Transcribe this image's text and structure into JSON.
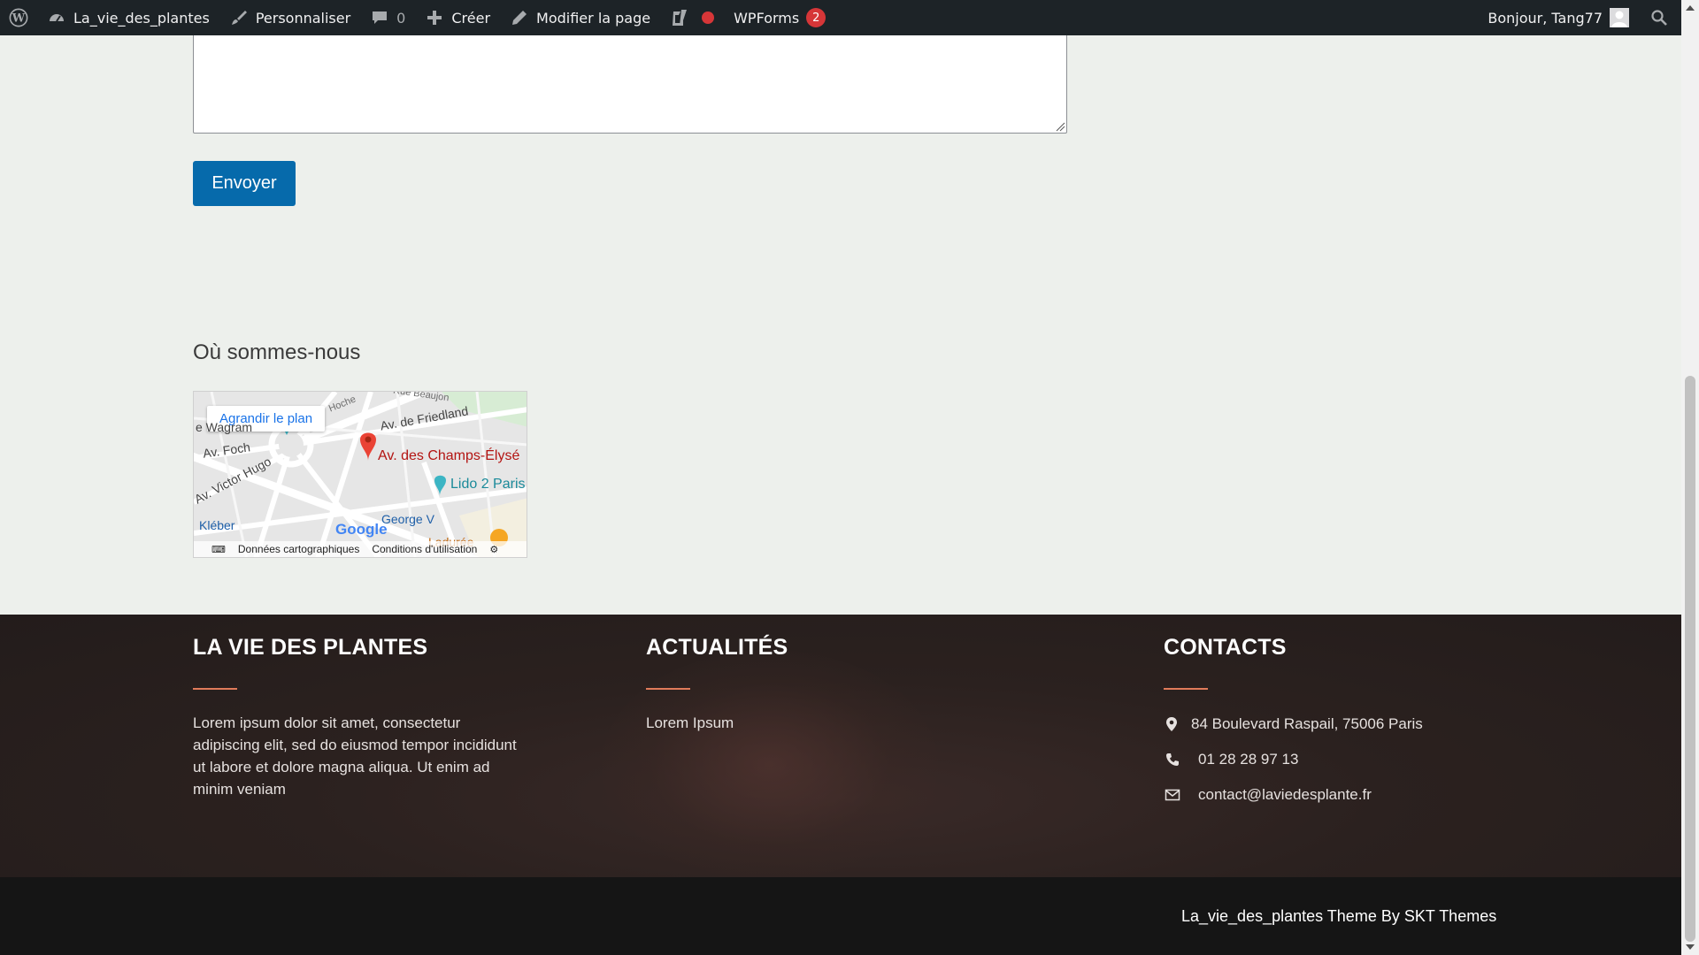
{
  "adminbar": {
    "site_name": "La_vie_des_plantes",
    "customize": "Personnaliser",
    "comments_count": "0",
    "new": "Créer",
    "edit_page": "Modifier la page",
    "wpforms": "WPForms",
    "wpforms_count": "2",
    "greeting": "Bonjour, Tang77",
    "icons": [
      "wordpress-logo-icon",
      "dashboard-icon",
      "brush-icon",
      "comment-icon",
      "plus-icon",
      "pencil-icon",
      "yoast-icon",
      "red-dot-icon",
      "avatar-icon",
      "search-icon"
    ]
  },
  "form": {
    "message_value": "",
    "submit_label": "Envoyer"
  },
  "map_section": {
    "heading": "Où sommes-nous",
    "enlarge_link": "Agrandir le plan",
    "labels": {
      "beaujon": "Rue Beaujon",
      "hoche": "Hoche",
      "friedland": "Av. de Friedland",
      "foch": "Av. Foch",
      "champs": "Av. des Champs-Élysé",
      "victor_hugo": "Av. Victor Hugo",
      "lido": "Lido 2 Paris",
      "kleber": "Kléber",
      "george_v": "George V",
      "laduree": "Ladurée",
      "google": "Google",
      "wagram": "e Wagram"
    },
    "footer": {
      "map_data": "Données cartographiques",
      "terms": "Conditions d'utilisation"
    }
  },
  "footer": {
    "col1": {
      "title": "LA VIE DES PLANTES",
      "text": "Lorem ipsum dolor sit amet, consectetur adipiscing elit, sed do eiusmod tempor incididunt ut labore et dolore magna aliqua. Ut enim ad minim veniam"
    },
    "col2": {
      "title": "ACTUALITÉS",
      "link": "Lorem Ipsum"
    },
    "col3": {
      "title": "CONTACTS",
      "address": "84 Boulevard Raspail, 75006 Paris",
      "phone": "01 28 28 97 13",
      "email": "contact@laviedesplante.fr"
    },
    "accent_color": "#e07b5a",
    "credit": "La_vie_des_plantes Theme By SKT Themes"
  },
  "colors": {
    "adminbar_bg": "#1d2327",
    "button_bg": "#066aab",
    "page_bg": "#edf0ec",
    "footer_bg": "#2b211f",
    "bottom_bar_bg": "#151515",
    "map_pin": "#ea4335"
  }
}
